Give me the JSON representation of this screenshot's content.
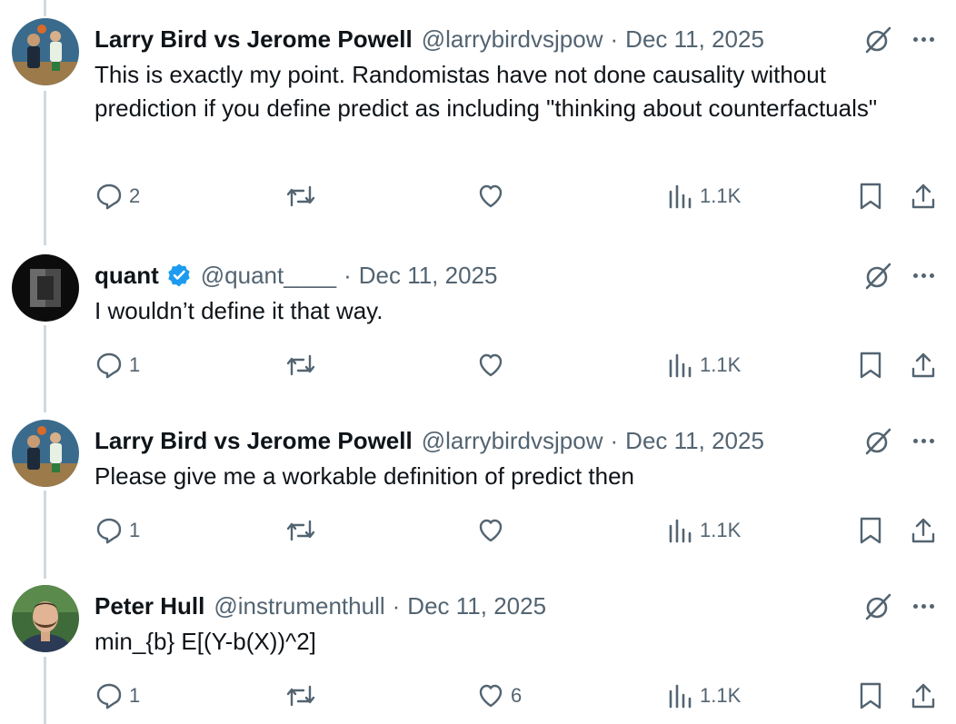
{
  "tweets": [
    {
      "name": "Larry Bird vs Jerome Powell",
      "handle": "@larrybirdvsjpow",
      "date": "Dec 11, 2025",
      "separator": "·",
      "verified": false,
      "avatar": "basketball-avatar",
      "text": "This is exactly my point. Randomistas have not done causality without prediction if you define predict as including \"thinking about counterfactuals\"",
      "replies": "2",
      "retweets": "",
      "likes": "",
      "views": "1.1K"
    },
    {
      "name": "quant",
      "handle": "@quant____",
      "date": "Dec 11, 2025",
      "separator": "·",
      "verified": true,
      "avatar": "dark-cube-avatar",
      "text": "I wouldn’t define it that way.",
      "replies": "1",
      "retweets": "",
      "likes": "",
      "views": "1.1K"
    },
    {
      "name": "Larry Bird vs Jerome Powell",
      "handle": "@larrybirdvsjpow",
      "date": "Dec 11, 2025",
      "separator": "·",
      "verified": false,
      "avatar": "basketball-avatar",
      "text": "Please give me a workable definition of predict then",
      "replies": "1",
      "retweets": "",
      "likes": "",
      "views": "1.1K"
    },
    {
      "name": "Peter Hull",
      "handle": "@instrumenthull",
      "date": "Dec 11, 2025",
      "separator": "·",
      "verified": false,
      "avatar": "person-photo-avatar",
      "text": "min_{b} E[(Y-b(X))^2]",
      "replies": "1",
      "retweets": "",
      "likes": "6",
      "views": "1.1K"
    }
  ],
  "colors": {
    "text": "#0f1419",
    "secondary": "#536471",
    "verified": "#1d9bf0",
    "thread_line": "#cfd9de"
  },
  "icons": [
    "reply-icon",
    "retweet-icon",
    "like-icon",
    "views-icon",
    "bookmark-icon",
    "share-icon",
    "grok-icon",
    "more-icon",
    "verified-badge-icon"
  ]
}
